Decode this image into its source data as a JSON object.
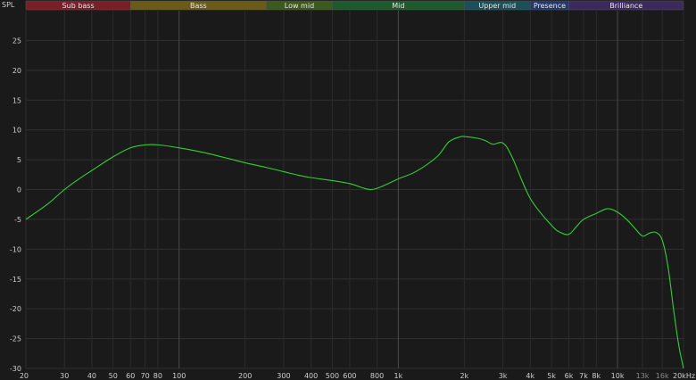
{
  "chart_data": {
    "type": "line",
    "ylabel": "SPL",
    "x_scale": "log",
    "xlim": [
      20,
      20000
    ],
    "ylim": [
      -30,
      30
    ],
    "grid": true,
    "line_color": "#2fd12f",
    "bands": [
      {
        "name": "Sub bass",
        "from": 20,
        "to": 60,
        "color": "#7a1f27"
      },
      {
        "name": "Bass",
        "from": 60,
        "to": 250,
        "color": "#6b5b17"
      },
      {
        "name": "Low mid",
        "from": 250,
        "to": 500,
        "color": "#3c5a1e"
      },
      {
        "name": "Mid",
        "from": 500,
        "to": 2000,
        "color": "#1f5a2c"
      },
      {
        "name": "Upper mid",
        "from": 2000,
        "to": 4000,
        "color": "#1c5058"
      },
      {
        "name": "Presence",
        "from": 4000,
        "to": 6000,
        "color": "#23386b"
      },
      {
        "name": "Brilliance",
        "from": 6000,
        "to": 20000,
        "color": "#3d2a5c"
      }
    ],
    "y_ticks": [
      {
        "v": 25,
        "label": "25"
      },
      {
        "v": 20,
        "label": "20"
      },
      {
        "v": 15,
        "label": "15"
      },
      {
        "v": 10,
        "label": "10"
      },
      {
        "v": 5,
        "label": "5"
      },
      {
        "v": 0,
        "label": "0"
      },
      {
        "v": -5,
        "label": "-5"
      },
      {
        "v": -10,
        "label": "-10"
      },
      {
        "v": -15,
        "label": "-15"
      },
      {
        "v": -20,
        "label": "-20"
      },
      {
        "v": -25,
        "label": "-25"
      },
      {
        "v": -30,
        "label": "-30"
      }
    ],
    "x_ticks": [
      {
        "v": 20,
        "label": "20"
      },
      {
        "v": 30,
        "label": "30"
      },
      {
        "v": 40,
        "label": "40"
      },
      {
        "v": 50,
        "label": "50"
      },
      {
        "v": 60,
        "label": "60"
      },
      {
        "v": 70,
        "label": "70"
      },
      {
        "v": 80,
        "label": "80"
      },
      {
        "v": 100,
        "label": "100"
      },
      {
        "v": 200,
        "label": "200"
      },
      {
        "v": 300,
        "label": "300"
      },
      {
        "v": 400,
        "label": "400"
      },
      {
        "v": 500,
        "label": "500"
      },
      {
        "v": 600,
        "label": "600"
      },
      {
        "v": 800,
        "label": "800"
      },
      {
        "v": 1000,
        "label": "1k"
      },
      {
        "v": 2000,
        "label": "2k"
      },
      {
        "v": 3000,
        "label": "3k"
      },
      {
        "v": 4000,
        "label": "4k"
      },
      {
        "v": 5000,
        "label": "5k"
      },
      {
        "v": 6000,
        "label": "6k"
      },
      {
        "v": 7000,
        "label": "7k"
      },
      {
        "v": 8000,
        "label": "8k"
      },
      {
        "v": 10000,
        "label": "10k"
      },
      {
        "v": 13000,
        "label": "13k",
        "dim": true
      },
      {
        "v": 16000,
        "label": "16k",
        "dim": true
      },
      {
        "v": 20000,
        "label": "20kHz"
      }
    ],
    "major_x": [
      100,
      1000,
      10000
    ],
    "series": [
      {
        "x": [
          20,
          25,
          30,
          35,
          40,
          50,
          60,
          70,
          80,
          100,
          130,
          160,
          200,
          250,
          300,
          350,
          400,
          500,
          600,
          700,
          750,
          800,
          900,
          1000,
          1200,
          1500,
          1700,
          1900,
          2000,
          2300,
          2500,
          2700,
          3000,
          3300,
          4000,
          5000,
          5500,
          6000,
          6500,
          7000,
          8000,
          9000,
          10000,
          11000,
          12000,
          13000,
          14000,
          15000,
          16000,
          17000,
          18000,
          19000,
          20000
        ],
        "y": [
          -5,
          -2.5,
          0,
          1.8,
          3.2,
          5.5,
          7,
          7.5,
          7.5,
          7,
          6.2,
          5.4,
          4.5,
          3.7,
          3,
          2.4,
          2,
          1.5,
          1,
          0.2,
          0,
          0.2,
          1,
          1.8,
          3,
          5.5,
          8,
          8.8,
          8.9,
          8.6,
          8.2,
          7.6,
          7.8,
          5.5,
          -1.5,
          -6,
          -7.2,
          -7.5,
          -6.2,
          -5,
          -4,
          -3.2,
          -3.8,
          -5,
          -6.5,
          -7.8,
          -7.3,
          -7.2,
          -8.5,
          -13,
          -20,
          -26,
          -30
        ]
      }
    ]
  }
}
